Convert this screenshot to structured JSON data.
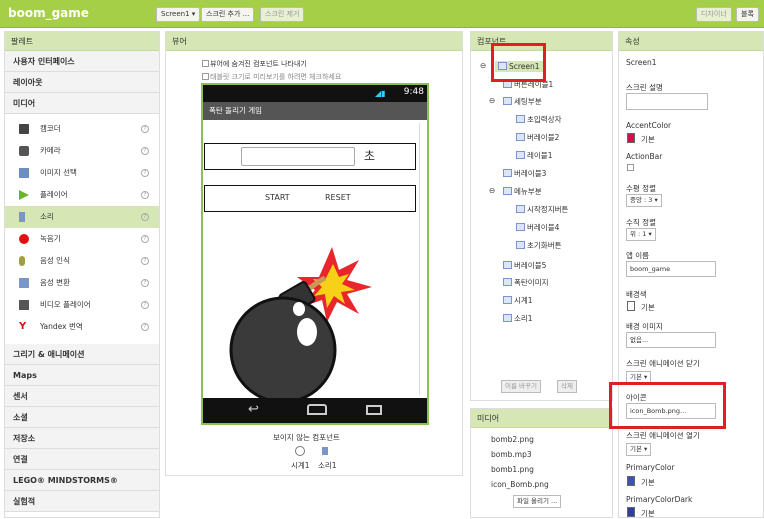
{
  "app": {
    "title": "boom_game",
    "screen_select": "Screen1 ▾",
    "add_screen": "스크린 추가 ...",
    "remove_screen": "스크린 제거",
    "designer": "디자이너",
    "blocks": "블록"
  },
  "palette": {
    "header": "팔레트",
    "categories_top": [
      "사용자 인터페이스",
      "레이아웃",
      "미디어"
    ],
    "items": [
      {
        "label": "캠코더",
        "icon": "camcorder-icon",
        "color": "#444"
      },
      {
        "label": "카메라",
        "icon": "camera-icon",
        "color": "#555"
      },
      {
        "label": "이미지 선택",
        "icon": "image-picker-icon",
        "color": "#6a8fc0"
      },
      {
        "label": "플레이어",
        "icon": "player-icon",
        "color": "#6bb52c"
      },
      {
        "label": "소리",
        "icon": "sound-icon",
        "color": "#7a96c8"
      },
      {
        "label": "녹음기",
        "icon": "recorder-icon",
        "color": "#e01010"
      },
      {
        "label": "음성 인식",
        "icon": "speech-recognizer-icon",
        "color": "#a0a040"
      },
      {
        "label": "음성 변환",
        "icon": "text-to-speech-icon",
        "color": "#7a96c8"
      },
      {
        "label": "비디오 플레이어",
        "icon": "video-player-icon",
        "color": "#555"
      },
      {
        "label": "Yandex 번역",
        "icon": "yandex-icon",
        "color": "#e01010"
      }
    ],
    "categories_bottom": [
      "그리기 & 애니메이션",
      "Maps",
      "센서",
      "소셜",
      "저장소",
      "연결",
      "LEGO® MINDSTORMS®",
      "실험적"
    ]
  },
  "viewer": {
    "header": "뷰어",
    "check_hidden": "뷰어에 숨겨진 컴포넌트 나타내기",
    "check_tablet": "태블릿 크기로 미리보기를 하려면 체크하세요",
    "status_time": "9:48",
    "phone_title": "폭탄 돌리기 게임",
    "sec_label": "초",
    "start": "START",
    "reset": "RESET",
    "nonvisible_title": "보이지 않는 컴포넌트",
    "nonvisible": [
      "시계1",
      "소리1"
    ]
  },
  "components": {
    "header": "컴포넌트",
    "tree": [
      "Screen1",
      "버튼레이블1",
      "세팅부분",
      "초입력상자",
      "버레이블2",
      "레이블1",
      "버레이블3",
      "메뉴부분",
      "시작정지버튼",
      "버레이블4",
      "초기화버튼",
      "버레이블5",
      "폭탄이미지",
      "시계1",
      "소리1"
    ],
    "rename": "이름 바꾸기",
    "delete": "삭제"
  },
  "media": {
    "header": "미디어",
    "files": [
      "bomb2.png",
      "bomb.mp3",
      "bomb1.png",
      "icon_Bomb.png"
    ],
    "upload": "파일 올리기 ..."
  },
  "properties": {
    "header": "속성",
    "screen": "Screen1",
    "about_label": "스크린 설명",
    "accent_label": "AccentColor",
    "accent_value": "기본",
    "accent_color": "#d0104a",
    "actionbar_label": "ActionBar",
    "align_h_label": "수평 정렬",
    "align_h_value": "중앙 : 3 ▾",
    "align_v_label": "수직 정렬",
    "align_v_value": "위 : 1 ▾",
    "appname_label": "앱 이름",
    "appname_value": "boom_game",
    "bgcolor_label": "배경색",
    "bgcolor_value": "기본",
    "bgimage_label": "배경 이미지",
    "bgimage_value": "없음...",
    "close_anim_label": "스크린 애니메이션 닫기",
    "close_anim_value": "기본 ▾",
    "icon_label": "아이콘",
    "icon_value": "icon_Bomb.png...",
    "open_anim_label": "스크린 애니메이션 열기",
    "open_anim_value": "기본 ▾",
    "primary_label": "PrimaryColor",
    "primary_value": "기본",
    "primary_color": "#3f51b5",
    "primary_dark_label": "PrimaryColorDark",
    "primary_dark_value": "기본",
    "primary_dark_color": "#303f9f"
  }
}
